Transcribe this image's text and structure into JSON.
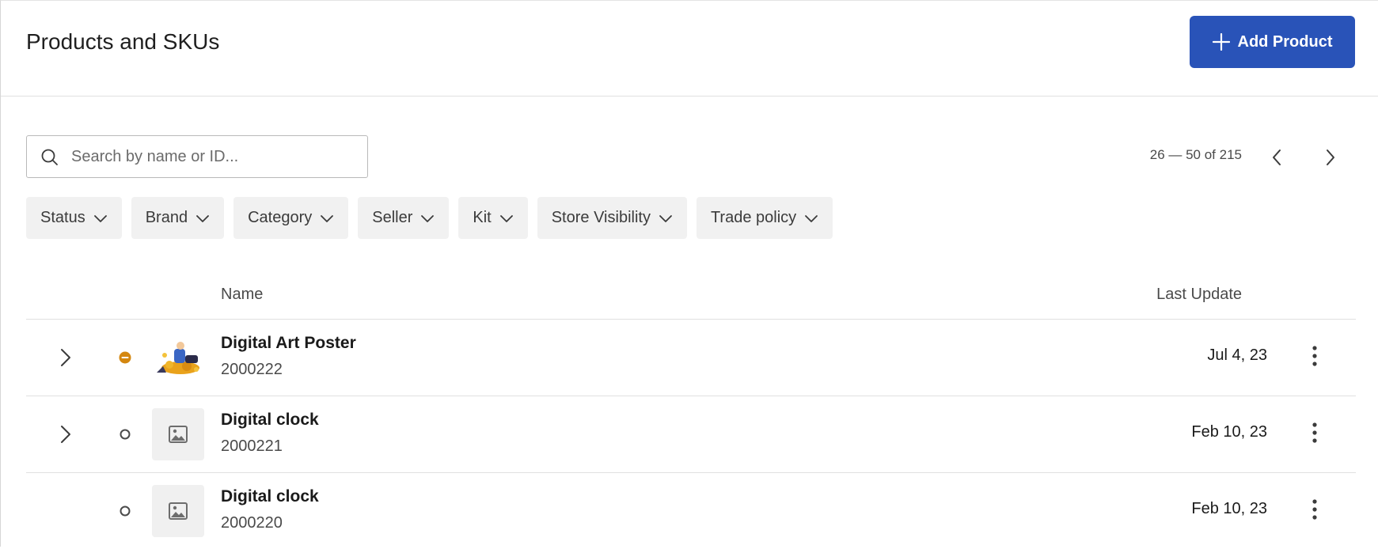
{
  "header": {
    "title": "Products and SKUs",
    "add_button_label": "Add Product"
  },
  "search": {
    "placeholder": "Search by name or ID...",
    "value": ""
  },
  "pagination": {
    "range_text": "26 — 50 of 215"
  },
  "filters": [
    {
      "label": "Status"
    },
    {
      "label": "Brand"
    },
    {
      "label": "Category"
    },
    {
      "label": "Seller"
    },
    {
      "label": "Kit"
    },
    {
      "label": "Store Visibility"
    },
    {
      "label": "Trade policy"
    }
  ],
  "table": {
    "columns": {
      "name": "Name",
      "last_update": "Last Update"
    },
    "rows": [
      {
        "name": "Digital Art Poster",
        "id": "2000222",
        "last_update": "Jul 4, 23",
        "status": "partial",
        "image": "art-illustration",
        "expandable": true
      },
      {
        "name": "Digital clock",
        "id": "2000221",
        "last_update": "Feb 10, 23",
        "status": "inactive",
        "image": "image-placeholder",
        "expandable": true
      },
      {
        "name": "Digital clock",
        "id": "2000220",
        "last_update": "Feb 10, 23",
        "status": "inactive",
        "image": "image-placeholder",
        "expandable": false
      }
    ]
  },
  "colors": {
    "accent": "#2953b8",
    "status_partial": "#d4870f",
    "status_inactive": "#4a4a4a",
    "chip_bg": "#f1f1f1"
  }
}
